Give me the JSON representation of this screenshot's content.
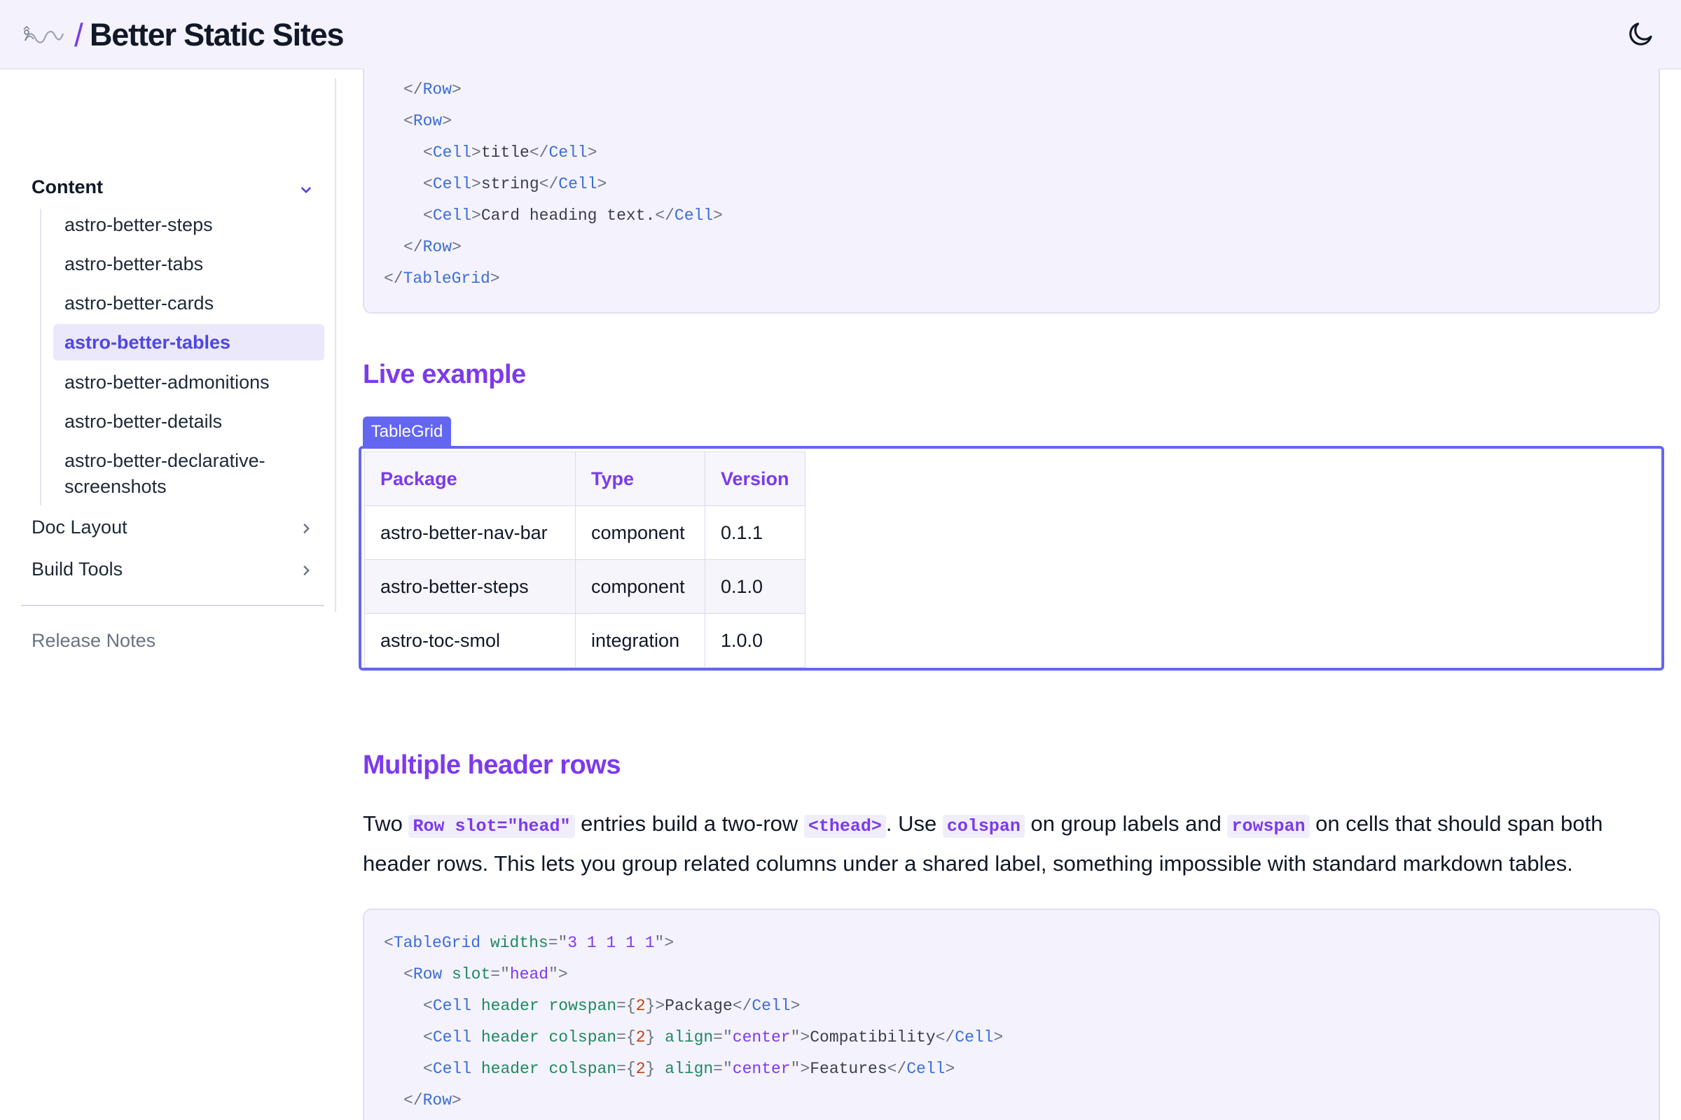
{
  "header": {
    "logo_icon": "snake-logo-icon",
    "separator": "/",
    "title": "Better Static Sites",
    "theme_toggle_icon": "moon-icon"
  },
  "sidebar": {
    "groups": [
      {
        "label": "Content",
        "expanded": true,
        "items": [
          {
            "label": "astro-better-steps",
            "active": false
          },
          {
            "label": "astro-better-tabs",
            "active": false
          },
          {
            "label": "astro-better-cards",
            "active": false
          },
          {
            "label": "astro-better-tables",
            "active": true
          },
          {
            "label": "astro-better-admonitions",
            "active": false
          },
          {
            "label": "astro-better-details",
            "active": false
          },
          {
            "label": "astro-better-declarative-",
            "label_line2": "screenshots",
            "active": false
          }
        ]
      },
      {
        "label": "Doc Layout",
        "expanded": false
      },
      {
        "label": "Build Tools",
        "expanded": false
      }
    ],
    "release_notes": "Release Notes"
  },
  "code_top": {
    "lines": [
      [
        "</",
        "Row",
        ">"
      ],
      [
        "<",
        "Row",
        ">"
      ],
      [
        "<",
        "Cell",
        ">",
        "title",
        "</",
        "Cell",
        ">"
      ],
      [
        "<",
        "Cell",
        ">",
        "string",
        "</",
        "Cell",
        ">"
      ],
      [
        "<",
        "Cell",
        ">",
        "Card heading text.",
        "</",
        "Cell",
        ">"
      ],
      [
        "</",
        "Row",
        ">"
      ],
      [
        "</",
        "TableGrid",
        ">"
      ]
    ]
  },
  "live_example": {
    "heading": "Live example",
    "badge": "TableGrid",
    "table": {
      "headers": [
        "Package",
        "Type",
        "Version"
      ],
      "rows": [
        [
          "astro-better-nav-bar",
          "component",
          "0.1.1"
        ],
        [
          "astro-better-steps",
          "component",
          "0.1.0"
        ],
        [
          "astro-toc-smol",
          "integration",
          "1.0.0"
        ]
      ]
    }
  },
  "multiple_header_rows": {
    "heading": "Multiple header rows",
    "para": {
      "t1": "Two ",
      "c1": "Row slot=\"head\"",
      "t2": " entries build a two-row ",
      "c2": "<thead>",
      "t3": ". Use ",
      "c3": "colspan",
      "t4": " on group labels and ",
      "c4": "rowspan",
      "t5": " on cells that should span both header rows. This lets you group related columns under a shared label, something impossible with standard markdown tables."
    }
  },
  "code_bottom": {
    "l1": {
      "tag": "TableGrid",
      "attr": "widths",
      "val": "3 1 1 1 1"
    },
    "l2": {
      "tag": "Row",
      "attr": "slot",
      "val": "head"
    },
    "l3": {
      "tag": "Cell",
      "a1": "header",
      "a2": "rowspan",
      "num": "2",
      "text": "Package"
    },
    "l4": {
      "tag": "Cell",
      "a1": "header",
      "a2": "colspan",
      "num": "2",
      "a3": "align",
      "val": "center",
      "text": "Compatibility"
    },
    "l5": {
      "tag": "Cell",
      "a1": "header",
      "a2": "colspan",
      "num": "2",
      "a3": "align",
      "val": "center",
      "text": "Features"
    },
    "l6": {
      "tag": "Row"
    }
  },
  "colors": {
    "accent": "#7c3aed",
    "primary": "#6366f1",
    "header_bg": "#f4f2fd"
  }
}
